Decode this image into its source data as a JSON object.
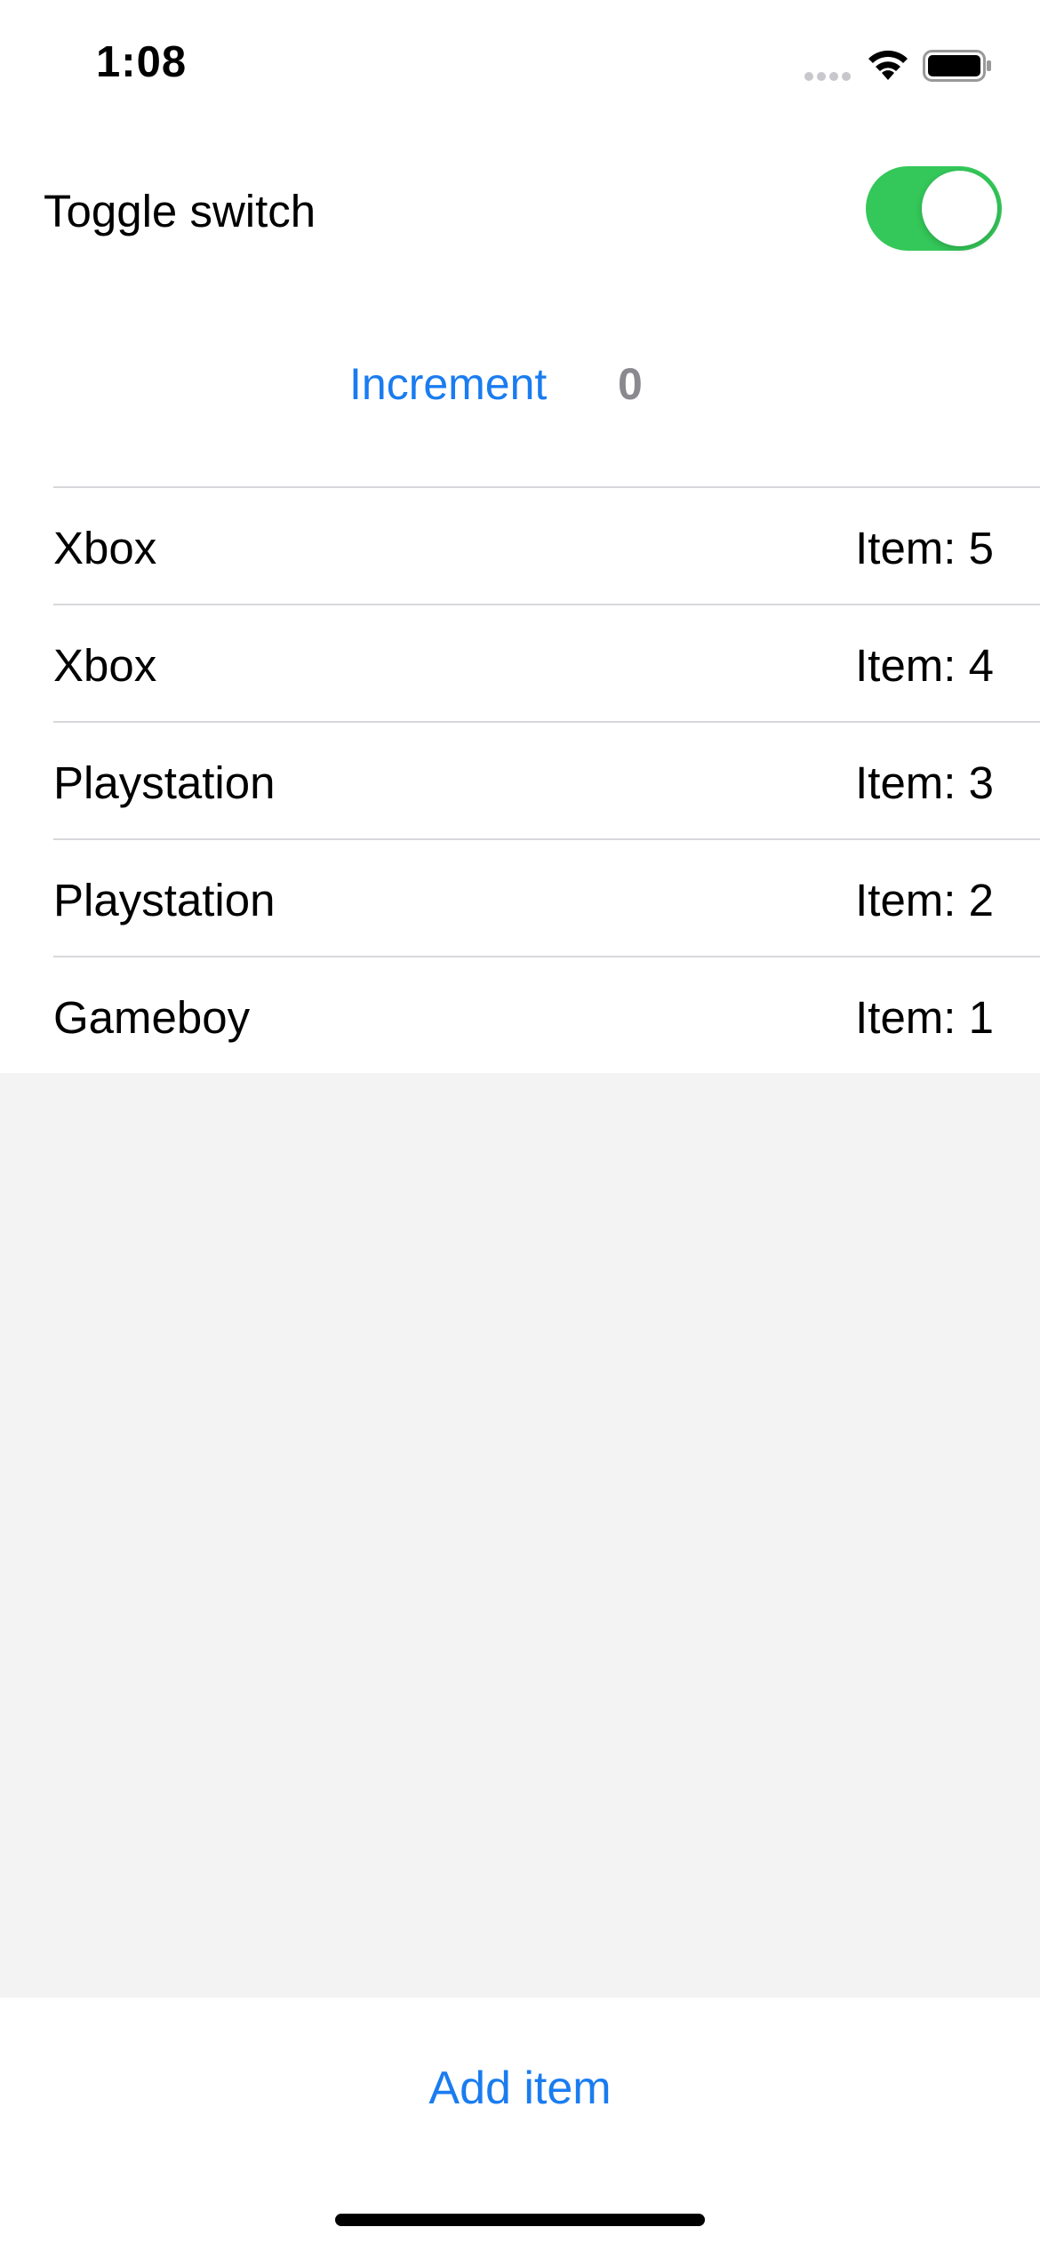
{
  "status_bar": {
    "time": "1:08",
    "icons": [
      "cellular-signal-icon",
      "wifi-icon",
      "battery-icon"
    ]
  },
  "toggle": {
    "label": "Toggle switch",
    "is_on": true,
    "on_color": "#34c759"
  },
  "counter": {
    "button_label": "Increment",
    "value": "0"
  },
  "items": [
    {
      "name": "Xbox",
      "value": "Item: 5"
    },
    {
      "name": "Xbox",
      "value": "Item: 4"
    },
    {
      "name": "Playstation",
      "value": "Item: 3"
    },
    {
      "name": "Playstation",
      "value": "Item: 2"
    },
    {
      "name": "Gameboy",
      "value": "Item: 1"
    }
  ],
  "footer": {
    "add_label": "Add item"
  },
  "colors": {
    "accent": "#1a7cf0",
    "secondary_text": "#8a8a8e",
    "background_empty": "#f3f3f3"
  }
}
